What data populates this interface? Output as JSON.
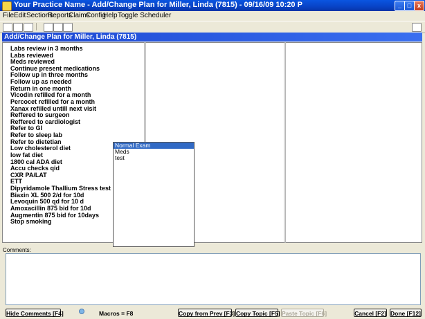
{
  "window": {
    "title": "Your Practice Name -  Add/Change Plan for Miller, Linda (7815) - 09/16/09 10:20 P",
    "minimize_label": "_",
    "maximize_label": "□",
    "close_label": "x"
  },
  "menu": [
    "File",
    "Edit",
    "Sections",
    "Reports",
    "Claims",
    "Config",
    "Help",
    "Toggle Scheduler"
  ],
  "toolbar_icons": [
    "new-icon",
    "edit-icon",
    "save-icon",
    "forward-icon",
    "page-icon",
    "print-icon",
    "export-icon"
  ],
  "panel": {
    "header": "Add/Change Plan for Miller, Linda (7815)"
  },
  "plan_items": [
    "Labs review in 3 months",
    "Labs reviewed",
    "Meds reviewed",
    "Continue present medications",
    "Follow up in three months",
    "Follow up as needed",
    "Return in one month",
    "Vicodin refilled for a month",
    "Percocet refilled for a month",
    "Xanax refilled untill next visit",
    "Reffered to surgeon",
    "Reffered to cardiologist",
    "Refer to GI",
    "Refer to sleep lab",
    "Refer to dietetian",
    "Low cholesterol diet",
    "low fat diet",
    "1800 cal ADA diet",
    "Accu checks qid",
    "CXR PA/LAT",
    "ETT",
    "Dipyridamole Thallium Stress test",
    "Biaxin XL 500 2/d for 10d",
    "Levoquin 500 qd for 10 d",
    "Amoxacillin 875 bid for 10d",
    "Augmentin 875 bid for 10days",
    "Stop smoking"
  ],
  "dropdown": {
    "items": [
      "Normal Exam",
      "Meds",
      "test"
    ],
    "selected": "Normal Exam"
  },
  "comments": {
    "label": "Comments:",
    "value": ""
  },
  "buttons": {
    "hide_comments": "Hide Comments [F4]",
    "macros": "Macros = F8",
    "copy_from_prev": "Copy from Prev [F3]",
    "copy_topic": "Copy Topic [F5]",
    "paste_topic": "Paste Topic [F6]",
    "cancel": "Cancel [F2]",
    "done": "Done [F12]"
  }
}
